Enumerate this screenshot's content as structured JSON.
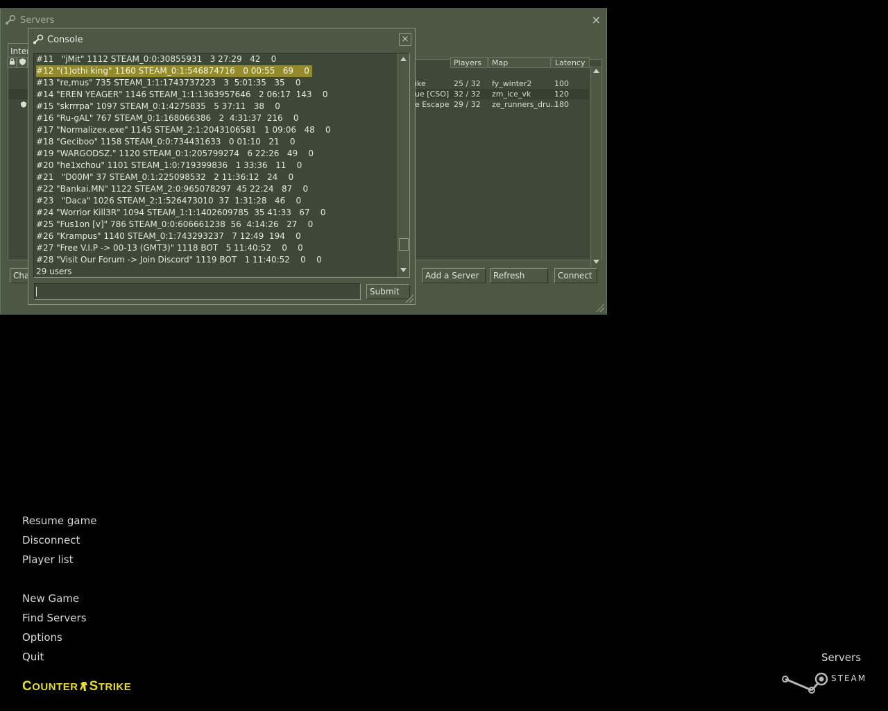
{
  "servers_window": {
    "title": "Servers",
    "close_glyph": "×",
    "tab_internet": "Inter",
    "columns": {
      "lock": "lock-icon",
      "secure": "shield-icon",
      "players": "Players",
      "map": "Map",
      "latency": "Latency"
    },
    "rows": [
      {
        "name": "ike",
        "players": "25 / 32",
        "map": "fy_winter2",
        "latency": "100"
      },
      {
        "name": "ue [CSO]",
        "players": "32 / 32",
        "map": "zm_ice_vk",
        "latency": "120"
      },
      {
        "name": "e Escape",
        "players": "29 / 32",
        "map": "ze_runners_dru…",
        "latency": "180"
      }
    ],
    "buttons": {
      "change_filters": "Cha",
      "add_server": "Add a Server",
      "refresh": "Refresh",
      "connect": "Connect"
    }
  },
  "console": {
    "title": "Console",
    "close_glyph": "×",
    "lines": [
      "#11   \"jMit\" 1112 STEAM_0:0:30855931   3 27:29   42    0",
      "#12 \"(1)othi king\" 1160 STEAM_0:1:546874716   0 00:55   69    0",
      "#13 \"re,mus\" 735 STEAM_1:1:1743737223   3  5:01:35   35    0",
      "#14 \"EREN YEAGER\" 1146 STEAM_1:1:1363957646   2 06:17  143    0",
      "#15 \"skrrrpa\" 1097 STEAM_0:1:4275835   5 37:11   38    0",
      "#16 \"Ru-gAL\" 767 STEAM_0:1:168066386   2  4:31:37  216    0",
      "#17 \"Normalizex.exe\" 1145 STEAM_2:1:2043106581   1 09:06   48    0",
      "#18 \"Geciboo\" 1158 STEAM_0:0:734431633   0 01:10   21    0",
      "#19 \"WARGODSZ.\" 1120 STEAM_0:1:205799274   6 22:26   49    0",
      "#20 \"he1xchou\" 1101 STEAM_1:0:719399836   1 33:36   11    0",
      "#21   \"D00M\" 37 STEAM_0:1:225098532   2 11:36:12   24    0",
      "#22 \"Bankai.MN\" 1122 STEAM_2:0:965078297  45 22:24   87    0",
      "#23   \"Daca\" 1026 STEAM_2:1:526473010  37  1:31:28   46    0",
      "#24 \"Worrior Kill3R\" 1094 STEAM_1:1:1402609785  35 41:33   67    0",
      "#25 \"Fus1on [v]\" 786 STEAM_0:0:606661238  56  4:14:26   27    0",
      "#26 \"Krampus\" 1140 STEAM_0:1:743293237   7 12:49  194    0",
      "#27 \"Free V.I.P -> 00-13 (GMT3)\" 1118 BOT   5 11:40:52    0    0",
      "#28 \"Visit Our Forum -> Join Discord\" 1119 BOT   1 11:40:52    0    0",
      "29 users"
    ],
    "selected_line_index": 1,
    "input_value": "",
    "submit_label": "Submit"
  },
  "main_menu": {
    "items": [
      "Resume game",
      "Disconnect",
      "Player list",
      "New Game",
      "Find Servers",
      "Options",
      "Quit"
    ]
  },
  "logo": {
    "part1_big": "C",
    "part1_small": "OUNTER",
    "part2_big": "S",
    "part2_small": "TRIKE"
  },
  "taskbar": {
    "servers_label": "Servers",
    "steam_label": "STEAM"
  },
  "colors": {
    "logo_yellow": "#e4dc34",
    "selection": "#958a2a",
    "panel": "#4c5844"
  }
}
